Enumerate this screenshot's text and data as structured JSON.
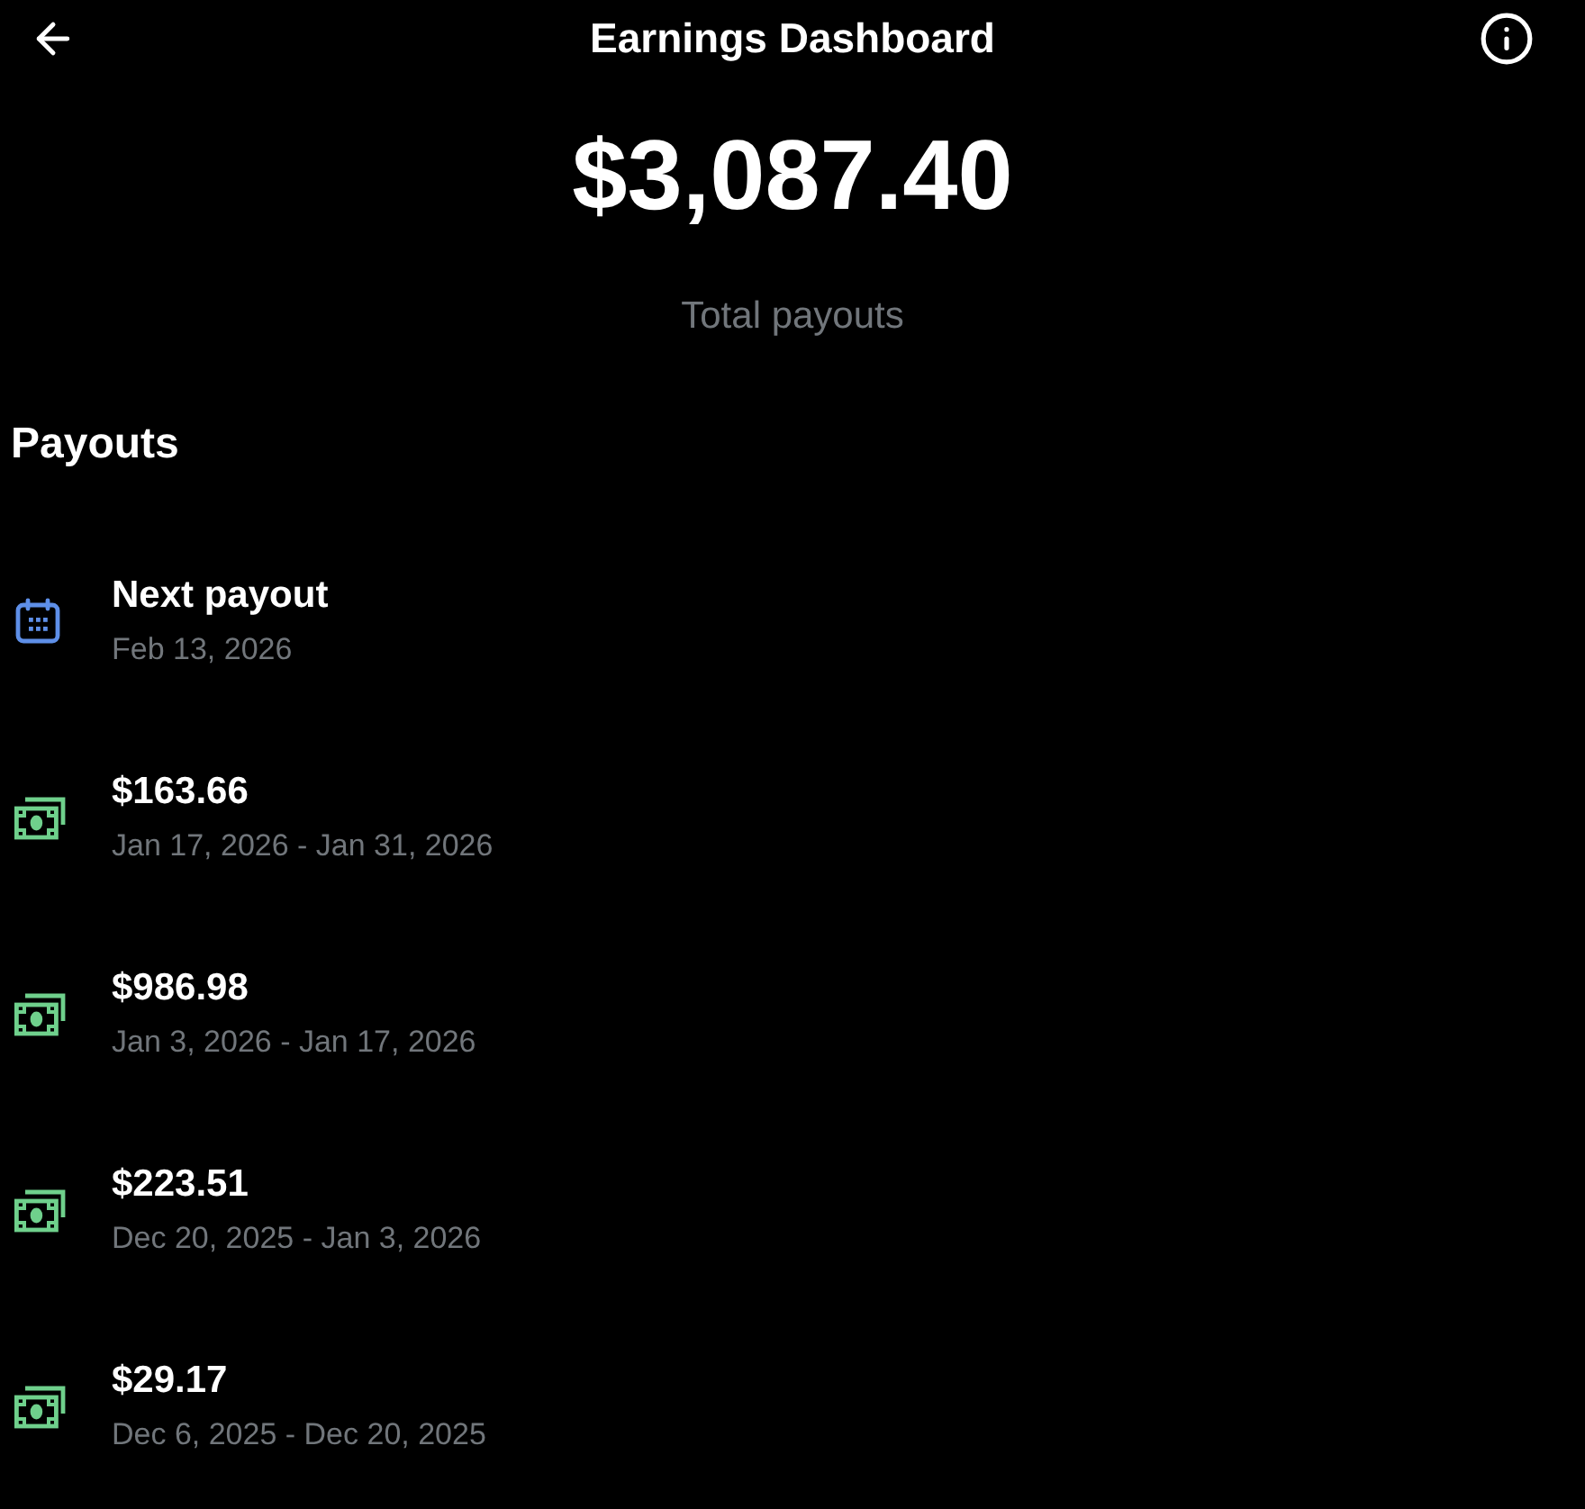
{
  "header": {
    "title": "Earnings Dashboard"
  },
  "summary": {
    "amount": "$3,087.40",
    "label": "Total payouts"
  },
  "payouts": {
    "heading": "Payouts",
    "items": [
      {
        "kind": "scheduled",
        "title": "Next payout",
        "date": "Feb 13, 2026"
      },
      {
        "kind": "paid",
        "title": "$163.66",
        "date": "Jan 17, 2026 - Jan 31, 2026"
      },
      {
        "kind": "paid",
        "title": "$986.98",
        "date": "Jan 3, 2026 - Jan 17, 2026"
      },
      {
        "kind": "paid",
        "title": "$223.51",
        "date": "Dec 20, 2025 - Jan 3, 2026"
      },
      {
        "kind": "paid",
        "title": "$29.17",
        "date": "Dec 6, 2025 - Dec 20, 2025"
      }
    ]
  }
}
